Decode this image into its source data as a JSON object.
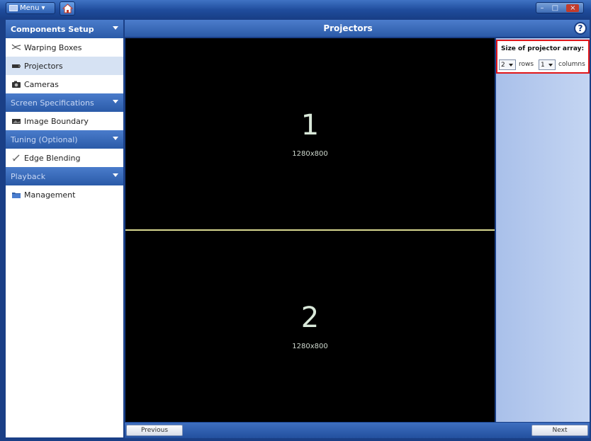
{
  "titlebar": {
    "menu_label": "Menu"
  },
  "sidebar": {
    "sections": [
      {
        "title": "Components Setup",
        "items": [
          {
            "label": "Warping Boxes",
            "icon": "warping-boxes-icon"
          },
          {
            "label": "Projectors",
            "icon": "projector-icon",
            "active": true
          },
          {
            "label": "Cameras",
            "icon": "camera-icon"
          }
        ]
      },
      {
        "title": "Screen Specifications",
        "items": [
          {
            "label": "Image Boundary",
            "icon": "image-boundary-icon"
          }
        ]
      },
      {
        "title": "Tuning (Optional)",
        "items": [
          {
            "label": "Edge Blending",
            "icon": "edge-blending-icon"
          }
        ]
      },
      {
        "title": "Playback",
        "items": [
          {
            "label": "Management",
            "icon": "folder-icon"
          }
        ]
      }
    ]
  },
  "header": {
    "title": "Projectors",
    "help_icon": "?"
  },
  "projectors": [
    {
      "number": "1",
      "resolution": "1280x800"
    },
    {
      "number": "2",
      "resolution": "1280x800"
    }
  ],
  "array_settings": {
    "label": "Size of projector array:",
    "rows_value": "2",
    "rows_unit": "rows",
    "columns_value": "1",
    "columns_unit": "columns"
  },
  "footer": {
    "previous_label": "Previous",
    "next_label": "Next"
  },
  "colors": {
    "highlight_border": "#e0161a",
    "divider": "#d8d890"
  }
}
